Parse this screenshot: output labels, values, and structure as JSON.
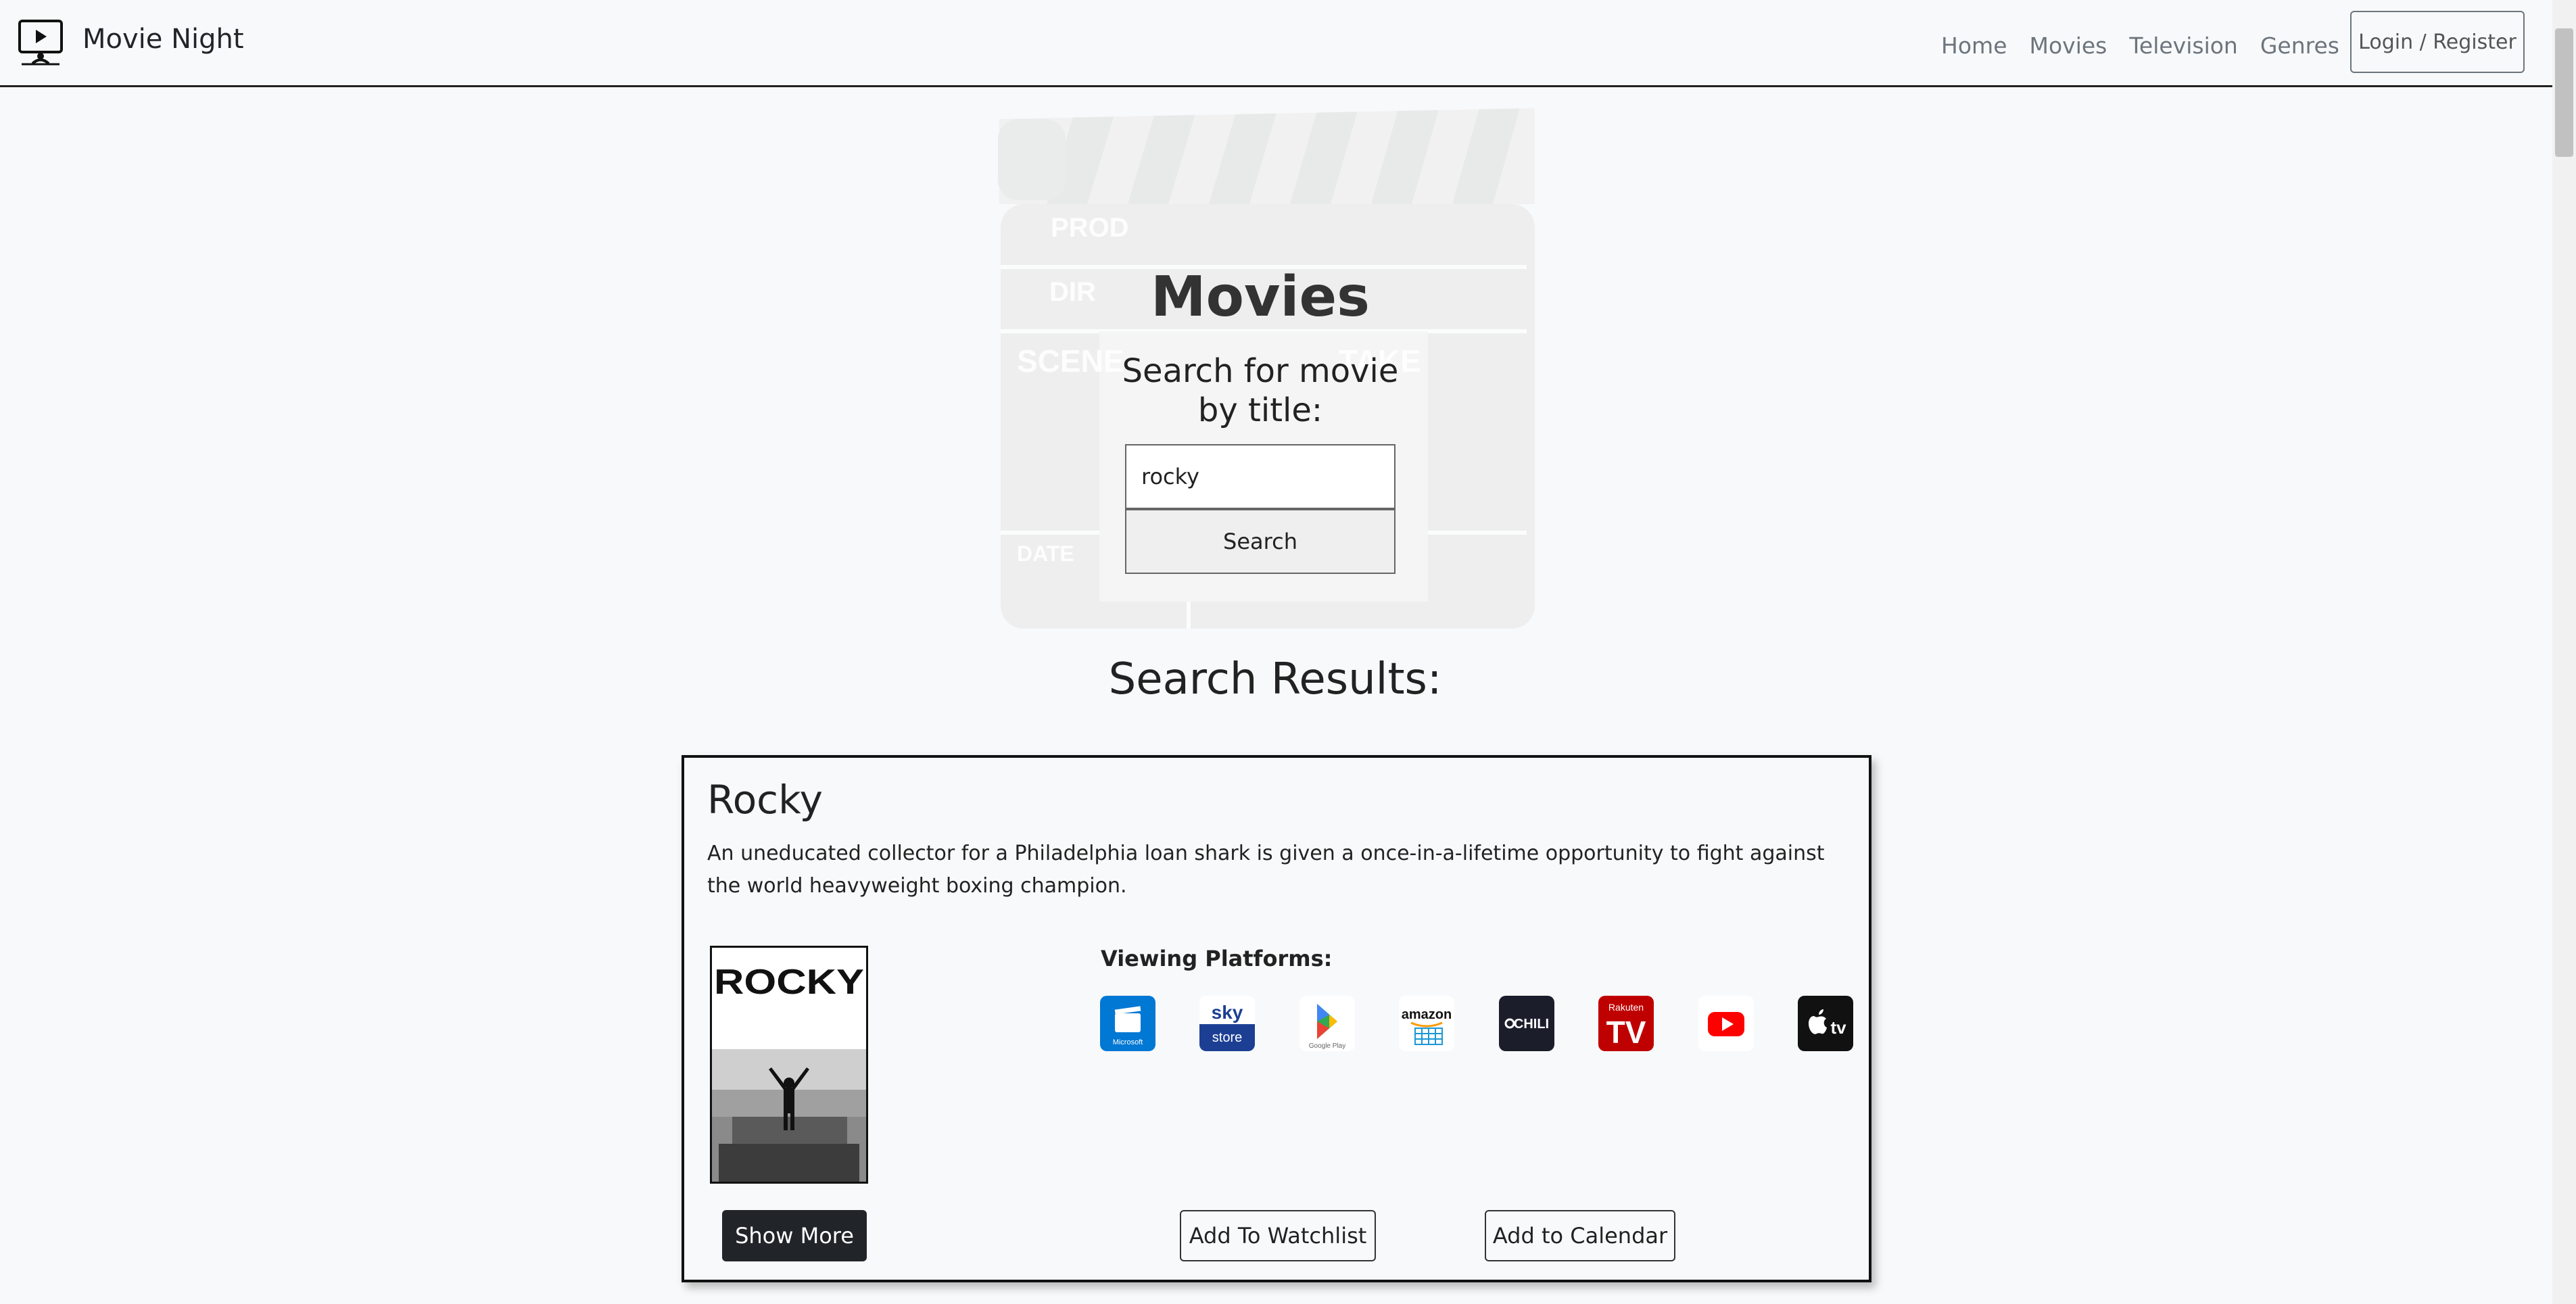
{
  "navbar": {
    "brand": "Movie Night",
    "links": [
      "Home",
      "Movies",
      "Television",
      "Genres"
    ],
    "login_label": "Login / Register"
  },
  "hero": {
    "title": "Movies",
    "clapperboard_labels": [
      "PROD",
      "DIR",
      "SCENE",
      "TAKE",
      "DATE"
    ],
    "search_label": "Search for movie by title:",
    "search_value": "rocky",
    "search_button": "Search"
  },
  "results": {
    "heading": "Search Results:",
    "items": [
      {
        "title": "Rocky",
        "description": "An uneducated collector for a Philadelphia loan shark is given a once-in-a-lifetime opportunity to fight against the world heavyweight boxing champion.",
        "poster_text": "ROCKY",
        "platforms_label": "Viewing Platforms:",
        "platforms": [
          {
            "name": "microsoft-movies-icon",
            "text": "Microsoft",
            "color": "#0078d4"
          },
          {
            "name": "sky-store-icon",
            "text": "sky store",
            "color": "#1c3f94"
          },
          {
            "name": "google-play-icon",
            "text": "Google Play",
            "color": "#ffffff"
          },
          {
            "name": "amazon-icon",
            "text": "amazon",
            "color": "#ffffff"
          },
          {
            "name": "chili-icon",
            "text": "CHILI",
            "color": "#1b1d2b"
          },
          {
            "name": "rakuten-tv-icon",
            "text": "Rakuten TV",
            "color": "#bf0000"
          },
          {
            "name": "youtube-icon",
            "text": "",
            "color": "#ffffff"
          },
          {
            "name": "apple-tv-icon",
            "text": "tv",
            "color": "#111111"
          }
        ],
        "show_more": "Show More",
        "watchlist": "Add To Watchlist",
        "calendar": "Add to Calendar"
      }
    ]
  }
}
